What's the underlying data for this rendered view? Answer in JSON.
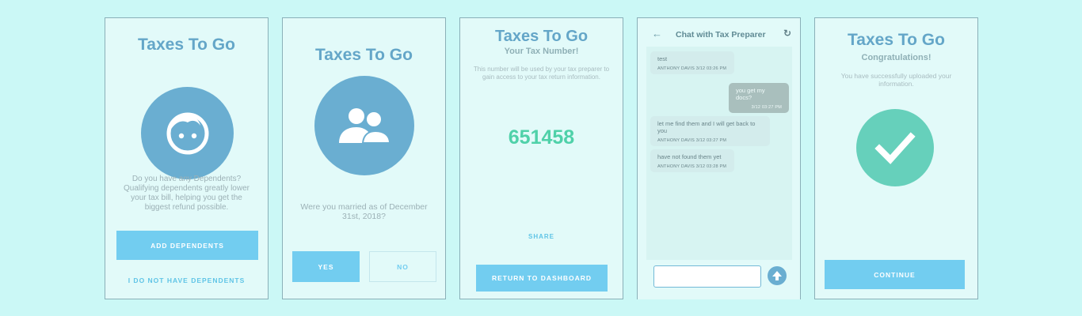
{
  "brand": "Taxes To Go",
  "colors": {
    "background": "#cbf8f6",
    "screen": "#e2faf9",
    "title": "#64a6c8",
    "accent_button": "#72cdf0",
    "circle": "#6aaed1",
    "code": "#4fd1a9",
    "success": "#66d0bb"
  },
  "screen1": {
    "title": "Taxes To Go",
    "icon": "child-face-icon",
    "text": "Do you have any Dependents? Qualifying dependents greatly lower your tax bill, helping you get the biggest refund possible.",
    "primary_button": "ADD DEPENDENTS",
    "secondary_link": "I DO NOT HAVE DEPENDENTS"
  },
  "screen2": {
    "title": "Taxes To Go",
    "icon": "people-icon",
    "text": "Were you married as of December 31st, 2018?",
    "yes_button": "YES",
    "no_button": "NO"
  },
  "screen3": {
    "title": "Taxes To Go",
    "subtitle": "Your Tax Number!",
    "text": "This number will be used by your tax preparer to gain access to your tax return information.",
    "code": "651458",
    "share_link": "SHARE",
    "dashboard_button": "RETURN TO DASHBOARD"
  },
  "screen4": {
    "back_icon": "arrow-left-icon",
    "title": "Chat with Tax Preparer",
    "refresh_icon": "refresh-icon",
    "messages": [
      {
        "text": "test",
        "meta": "ANTHONY DAVIS  3/12 03:26 PM",
        "direction": "in"
      },
      {
        "text": "you get my docs?",
        "meta": "3/12 03:27 PM",
        "direction": "out"
      },
      {
        "text": "let me find them and I will get back to you",
        "meta": "ANTHONY DAVIS  3/12 03:27 PM",
        "direction": "in"
      },
      {
        "text": "have not found them yet",
        "meta": "ANTHONY DAVIS  3/12 03:28 PM",
        "direction": "in"
      }
    ],
    "input_value": "",
    "send_icon": "arrow-up-icon"
  },
  "screen5": {
    "title": "Taxes To Go",
    "subtitle": "Congratulations!",
    "text": "You have successfully uploaded your information.",
    "icon": "checkmark-icon",
    "continue_button": "CONTINUE"
  }
}
